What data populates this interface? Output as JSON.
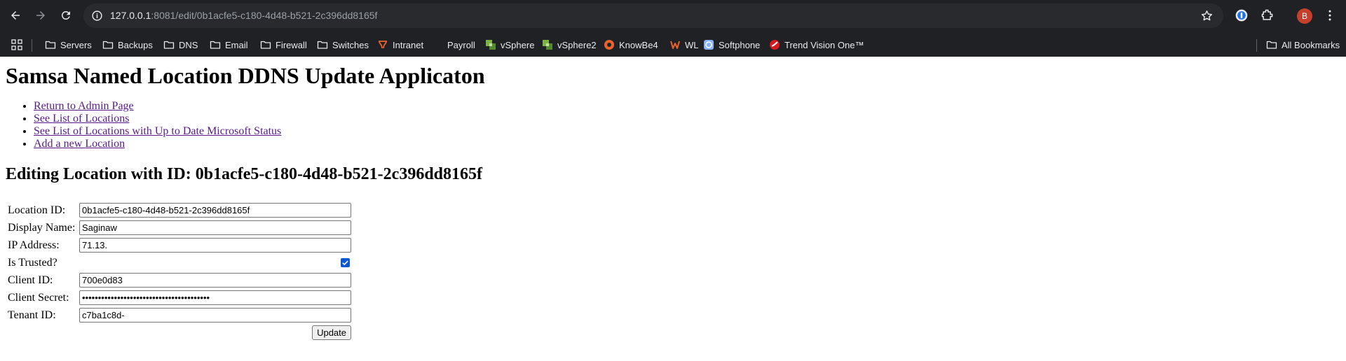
{
  "browser": {
    "url_host": "127.0.0.1",
    "url_rest": ":8081/edit/0b1acfe5-c180-4d48-b521-2c396dd8165f",
    "profile_initial": "B",
    "bookmarks": [
      {
        "label": "Servers",
        "icon": "folder-icon"
      },
      {
        "label": "Backups",
        "icon": "folder-icon"
      },
      {
        "label": "DNS",
        "icon": "folder-icon"
      },
      {
        "label": "Email",
        "icon": "folder-icon"
      },
      {
        "label": "Firewall",
        "icon": "folder-icon"
      },
      {
        "label": "Switches",
        "icon": "folder-icon"
      },
      {
        "label": "Intranet",
        "icon": "intranet-icon"
      },
      {
        "label": "Payroll",
        "icon": "blank-icon"
      },
      {
        "label": "vSphere",
        "icon": "vsphere-icon"
      },
      {
        "label": "vSphere2",
        "icon": "vsphere-icon"
      },
      {
        "label": "KnowBe4",
        "icon": "knowbe4-icon"
      },
      {
        "label": "WL",
        "icon": "wl-icon"
      },
      {
        "label": "Softphone",
        "icon": "softphone-icon"
      },
      {
        "label": "Trend Vision One™",
        "icon": "trend-icon"
      }
    ],
    "all_bookmarks": "All Bookmarks"
  },
  "page": {
    "title": "Samsa Named Location DDNS Update Applicaton",
    "links": [
      "Return to Admin Page",
      "See List of Locations",
      "See List of Locations with Up to Date Microsoft Status",
      "Add a new Location"
    ],
    "editing_heading": "Editing Location with ID: 0b1acfe5-c180-4d48-b521-2c396dd8165f"
  },
  "form": {
    "location_id_label": "Location ID:",
    "location_id_value": "0b1acfe5-c180-4d48-b521-2c396dd8165f",
    "display_name_label": "Display Name:",
    "display_name_value": "Saginaw",
    "ip_address_label": "IP Address:",
    "ip_address_value": "71.13.",
    "is_trusted_label": "Is Trusted?",
    "is_trusted_checked": true,
    "client_id_label": "Client ID:",
    "client_id_value": "700e0d83",
    "client_secret_label": "Client Secret:",
    "client_secret_value": "••••••••••••••••••••••••••••••••••••••••",
    "tenant_id_label": "Tenant ID:",
    "tenant_id_value": "c7ba1c8d-",
    "submit_label": "Update"
  },
  "colors": {
    "chrome_bg": "#202124",
    "omnibox_bg": "#282a2d",
    "visited_link": "#551a8b",
    "checkbox_accent": "#0b57d0"
  }
}
